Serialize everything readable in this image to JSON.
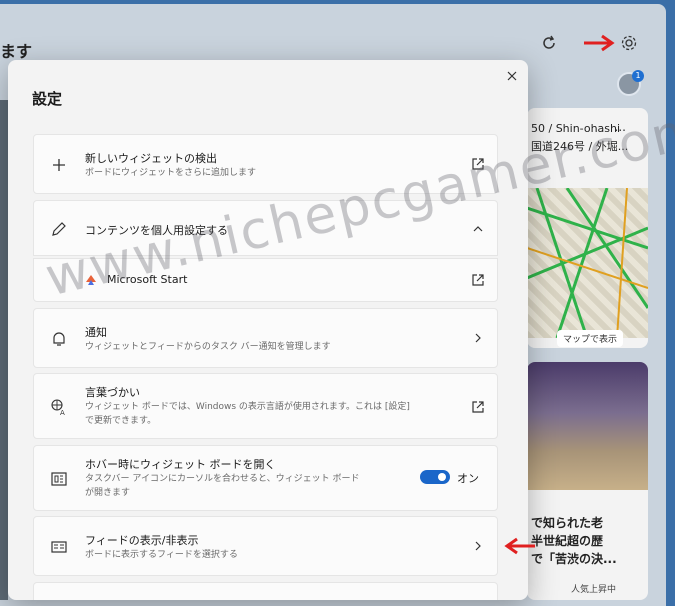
{
  "board": {
    "title_fragment": "ます",
    "map_card": {
      "lines": [
        "50 / Shin-ohashi",
        "国道246号 / 外堀..."
      ],
      "more": "...",
      "button": "マップで表示"
    },
    "bowl_card": {
      "lines": [
        "で知られた老",
        "半世紀超の歴",
        "で「苦渋の決..."
      ],
      "trend": "人気上昇中"
    },
    "avatar_badge": "1"
  },
  "dialog": {
    "title": "設定",
    "rows": [
      {
        "title": "新しいウィジェットの検出",
        "desc": "ボードにウィジェットをさらに追加します"
      },
      {
        "title": "コンテンツを個人用設定する",
        "desc": ""
      },
      {
        "title": "Microsoft Start",
        "desc": ""
      },
      {
        "title": "通知",
        "desc": "ウィジェットとフィードからのタスク バー通知を管理します"
      },
      {
        "title": "言葉づかい",
        "desc": "ウィジェット ボードでは、Windows の表示言語が使用されます。これは [設定] で更新できます。"
      },
      {
        "title": "ホバー時にウィジェット ボードを開く",
        "desc": "タスクバー アイコンにカーソルを合わせると、ウィジェット ボードが開きます",
        "toggle_label": "オン"
      },
      {
        "title": "フィードの表示/非表示",
        "desc": "ボードに表示するフィードを選択する"
      }
    ]
  },
  "watermark": "www.nichepcgamer.com",
  "colors": {
    "accent": "#1a66c9",
    "arrow": "#e02020"
  }
}
